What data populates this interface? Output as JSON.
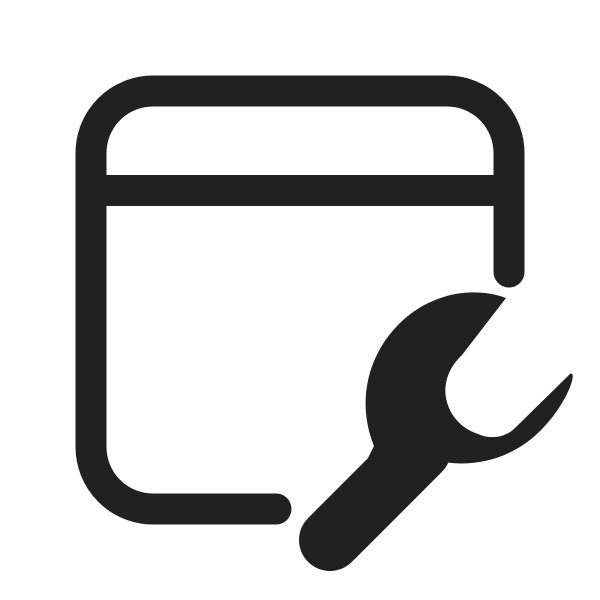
{
  "icon": {
    "name": "app-settings-wrench-icon",
    "color": "#212121",
    "background": "#ffffff",
    "parts": [
      "window-frame",
      "title-bar-divider",
      "wrench"
    ]
  }
}
